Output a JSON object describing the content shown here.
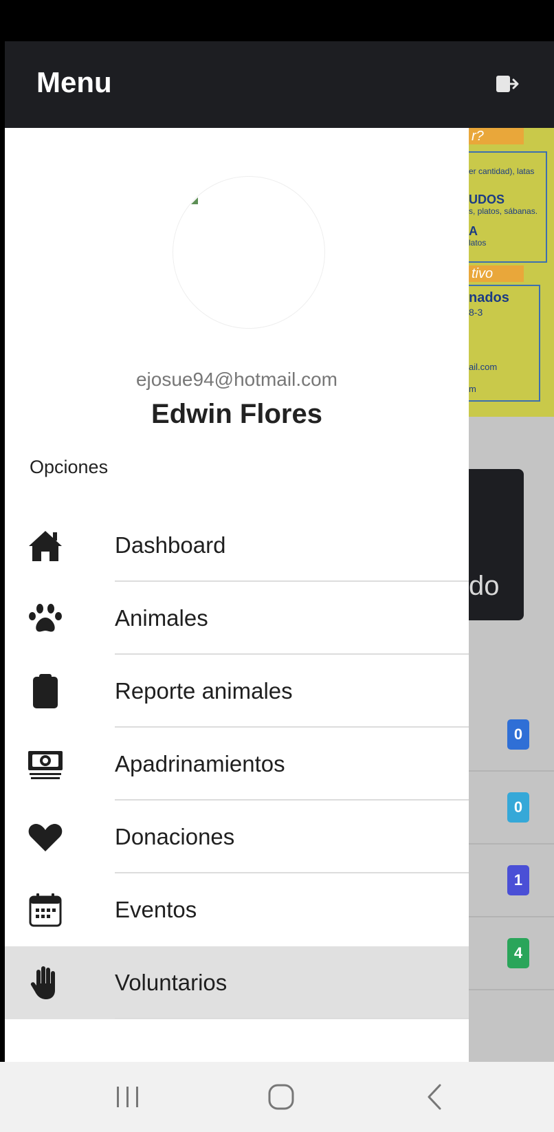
{
  "drawer": {
    "title": "Menu",
    "user": {
      "email": "ejosue94@hotmail.com",
      "name": "Edwin Flores"
    },
    "section_label": "Opciones",
    "items": [
      {
        "label": "Dashboard",
        "icon": "home-icon"
      },
      {
        "label": "Animales",
        "icon": "paw-icon"
      },
      {
        "label": "Reporte animales",
        "icon": "clipboard-icon"
      },
      {
        "label": "Apadrinamientos",
        "icon": "money-icon"
      },
      {
        "label": "Donaciones",
        "icon": "heart-icon"
      },
      {
        "label": "Eventos",
        "icon": "calendar-icon"
      },
      {
        "label": "Voluntarios",
        "icon": "hand-icon",
        "active": true
      }
    ]
  },
  "background": {
    "poster_lines": [
      "r?",
      "er cantidad), latas",
      "UDOS",
      "s, platos, sábanas.",
      "A",
      "latos",
      "tivo",
      "nados",
      "8-3",
      "ail.com",
      "m"
    ],
    "card_text": "do",
    "badges": [
      {
        "value": "0",
        "color": "#2f6fd6"
      },
      {
        "value": "0",
        "color": "#35a8d8"
      },
      {
        "value": "1",
        "color": "#4a4fd6"
      },
      {
        "value": "4",
        "color": "#2aa55a"
      }
    ]
  },
  "colors": {
    "header_bg": "#1d1e22",
    "active_item_bg": "#e0e0e0"
  }
}
